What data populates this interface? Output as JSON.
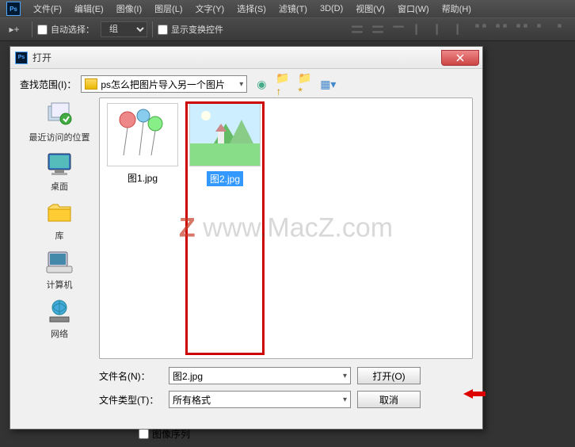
{
  "menubar": {
    "items": [
      "文件(F)",
      "编辑(E)",
      "图像(I)",
      "图层(L)",
      "文字(Y)",
      "选择(S)",
      "滤镜(T)",
      "3D(D)",
      "视图(V)",
      "窗口(W)",
      "帮助(H)"
    ]
  },
  "toolbar": {
    "auto_select_label": "自动选择：",
    "group_option": "组",
    "show_transform_label": "显示变换控件"
  },
  "dialog": {
    "title": "打开",
    "lookin_label": "查找范围(I)：",
    "lookin_value": "ps怎么把图片导入另一个图片",
    "sidebar": {
      "recent": "最近访问的位置",
      "desktop": "桌面",
      "library": "库",
      "computer": "计算机",
      "network": "网络"
    },
    "files": [
      {
        "name": "图1.jpg",
        "selected": false
      },
      {
        "name": "图2.jpg",
        "selected": true
      }
    ],
    "filename_label": "文件名(N)：",
    "filename_value": "图2.jpg",
    "filetype_label": "文件类型(T)：",
    "filetype_value": "所有格式",
    "open_btn": "打开(O)",
    "cancel_btn": "取消",
    "image_sequence_label": "图像序列"
  },
  "watermark": "www.MacZ.com"
}
